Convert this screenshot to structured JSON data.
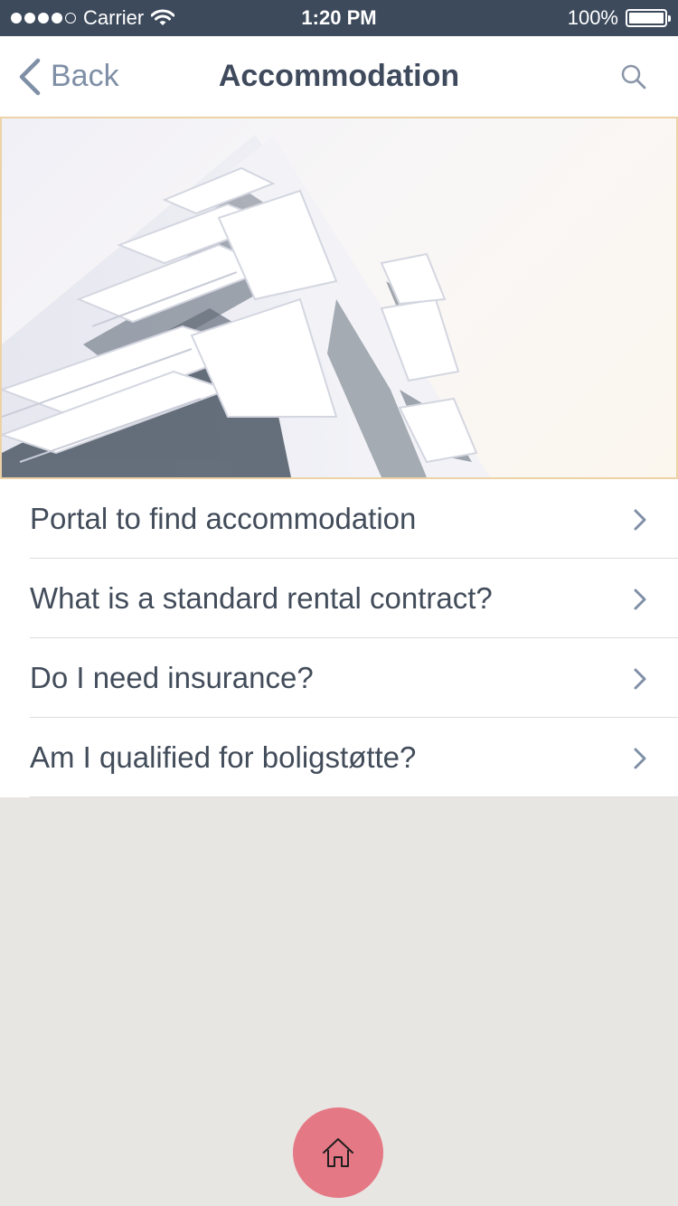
{
  "status_bar": {
    "carrier": "Carrier",
    "time": "1:20 PM",
    "battery": "100%",
    "signal_strength": 4
  },
  "nav": {
    "back_label": "Back",
    "title": "Accommodation"
  },
  "hero": {
    "icon": "apartment-building-photo"
  },
  "list": {
    "items": [
      {
        "label": "Portal to find accommodation"
      },
      {
        "label": "What is a standard rental contract?"
      },
      {
        "label": "Do I need insurance?"
      },
      {
        "label": "Am I qualified for boligstøtte?"
      }
    ]
  },
  "colors": {
    "status_bar": "#3d4a5c",
    "title_text": "#3f4b5d",
    "accent_muted": "#7f8fa6",
    "home_button": "#e57885",
    "hero_border": "#ecd2a6",
    "page_background": "#e8e6e3"
  }
}
